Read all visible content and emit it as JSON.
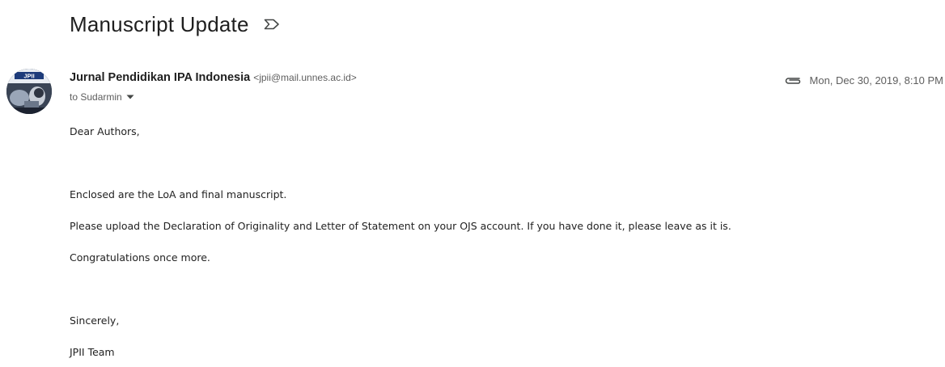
{
  "email": {
    "subject": "Manuscript Update",
    "sender": {
      "name": "Jurnal Pendidikan IPA Indonesia",
      "address": "<jpii@mail.unnes.ac.id>",
      "avatar_text": "JPII"
    },
    "attachment_icon": "paperclip-icon",
    "date": "Mon, Dec 30, 2019, 8:10 PM",
    "to": "to Sudarmin",
    "body": {
      "greeting": "Dear Authors,",
      "line1": "Enclosed are the LoA and final manuscript.",
      "line2": "Please upload the Declaration of Originality and Letter of Statement on your OJS account. If you have done it, please leave as it is.",
      "line3": "Congratulations once more.",
      "closing": "Sincerely,",
      "signature": "JPII Team"
    }
  },
  "colors": {
    "text_primary": "#1f1f1f",
    "text_secondary": "#5e5e5e",
    "body_text": "#222222"
  }
}
